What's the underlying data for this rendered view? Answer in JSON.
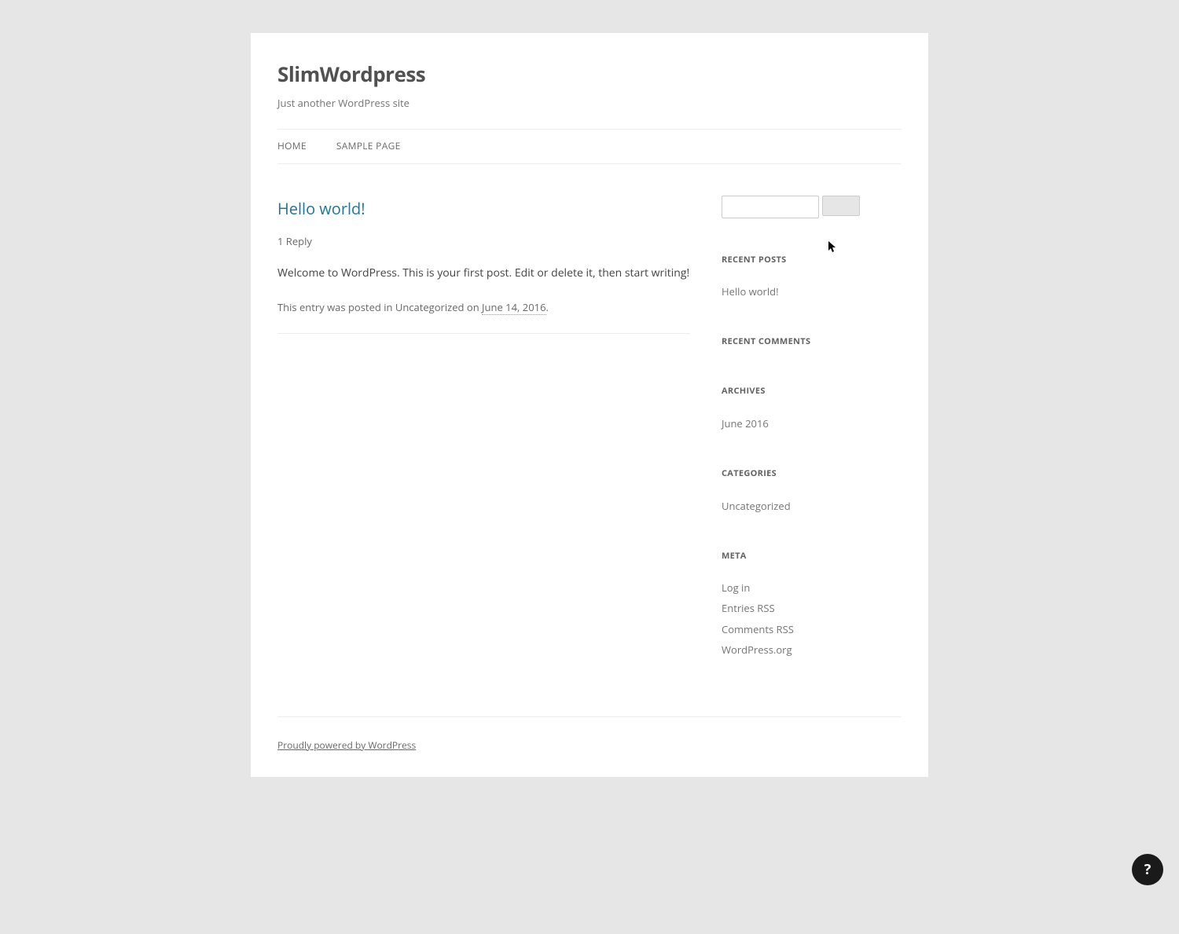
{
  "header": {
    "site_title": "SlimWordpress",
    "site_description": "Just another WordPress site"
  },
  "nav": {
    "items": [
      {
        "label": "HOME"
      },
      {
        "label": "SAMPLE PAGE"
      }
    ]
  },
  "post": {
    "title": "Hello world!",
    "comments_link": "1 Reply",
    "content": "Welcome to WordPress. This is your first post. Edit or delete it, then start writing!",
    "meta_prefix": "This entry was posted in ",
    "meta_category": "Uncategorized",
    "meta_on": " on ",
    "meta_date": "June 14, 2016",
    "meta_suffix": "."
  },
  "sidebar": {
    "recent_posts": {
      "title": "RECENT POSTS",
      "items": [
        {
          "label": "Hello world!"
        }
      ]
    },
    "recent_comments": {
      "title": "RECENT COMMENTS"
    },
    "archives": {
      "title": "ARCHIVES",
      "items": [
        {
          "label": "June 2016"
        }
      ]
    },
    "categories": {
      "title": "CATEGORIES",
      "items": [
        {
          "label": "Uncategorized"
        }
      ]
    },
    "meta": {
      "title": "META",
      "items": [
        {
          "label": "Log in"
        },
        {
          "label": "Entries RSS"
        },
        {
          "label": "Comments RSS"
        },
        {
          "label": "WordPress.org"
        }
      ]
    }
  },
  "footer": {
    "powered_by": "Proudly powered by WordPress"
  },
  "help": {
    "label": "?"
  }
}
